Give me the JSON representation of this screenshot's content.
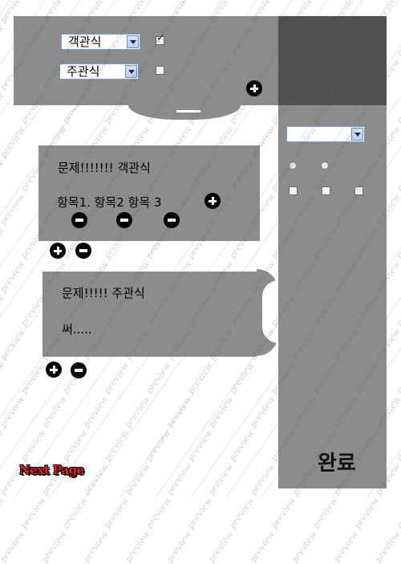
{
  "top_panel": {
    "select_objective": "객관식",
    "select_subjective": "주관식"
  },
  "question_objective": {
    "title": "문제!!!!!!! 객관식",
    "items": "항목1. 항목2 항목 3"
  },
  "question_subjective": {
    "title": "문제!!!!!  주관식",
    "answer": "써....."
  },
  "sidebar": {
    "select_value": "",
    "done_label": "완료"
  },
  "footer": {
    "next_page_label": "Next Page"
  },
  "watermark": {
    "text": "preview"
  },
  "icons": {
    "plus": "plus-circle-icon",
    "minus": "minus-circle-icon"
  },
  "colors": {
    "panel_gray": "#8c8c8c",
    "panel_dark": "#505050",
    "next_page_red": "#e31d1d"
  }
}
